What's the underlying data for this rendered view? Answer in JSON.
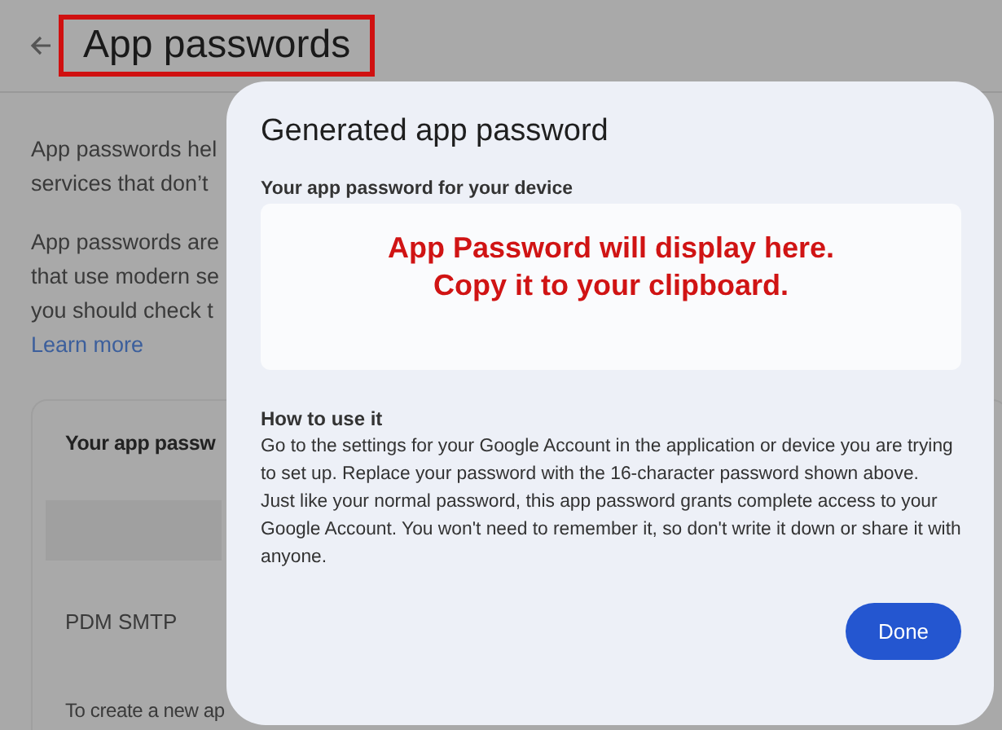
{
  "page": {
    "title": "App passwords",
    "intro_lines": [
      "App passwords hel",
      "services that don’t"
    ],
    "detail_lines": [
      "App passwords are",
      "that use modern se",
      "you should check t"
    ],
    "learn_more": "Learn more",
    "card": {
      "heading": "Your app passw",
      "items": [
        "PDM SMTP"
      ],
      "footer": "To create a new ap"
    }
  },
  "dialog": {
    "title": "Generated app password",
    "field_label": "Your app password for your device",
    "password_note_lines": [
      "App Password will display here.",
      "Copy it to your clipboard."
    ],
    "how_title": "How to use it",
    "how_paragraphs": [
      "Go to the settings for your Google Account in the application or device you are trying to set up. Replace your password with the 16-character password shown above.",
      "Just like your normal password, this app password grants complete access to your Google Account. You won't need to remember it, so don't write it down or share it with anyone."
    ],
    "button": "Done"
  }
}
